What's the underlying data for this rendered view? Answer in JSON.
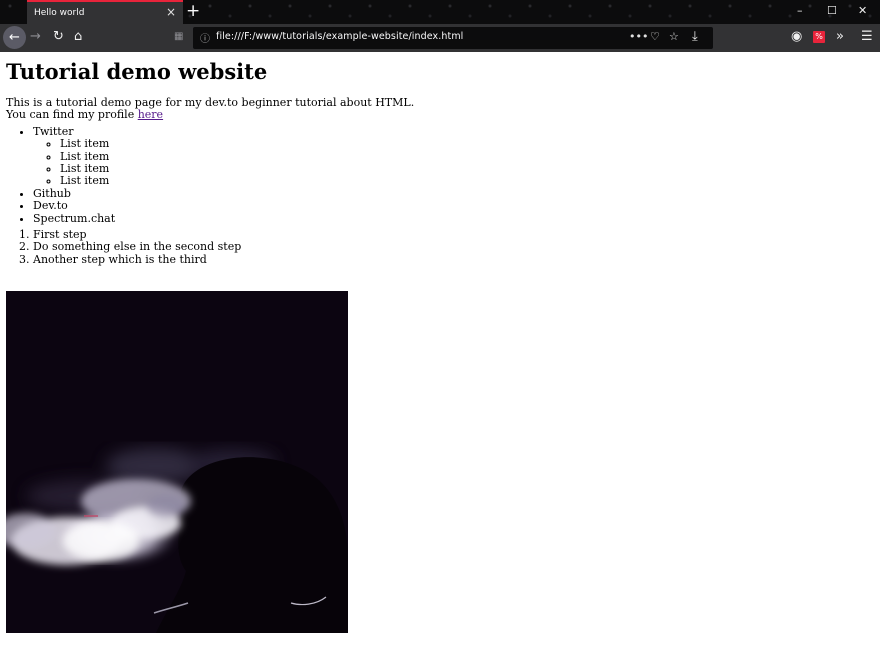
{
  "browser": {
    "tab_title": "Hello world",
    "tab_close": "×",
    "new_tab": "+",
    "window_controls": {
      "minimize": "–",
      "maximize": "☐",
      "close": "✕"
    },
    "url": "file:///F:/www/tutorials/example-website/index.html",
    "nav_icons": [
      "back-icon",
      "forward-icon",
      "reload-icon",
      "home-icon",
      "page-icon",
      "info-icon",
      "more-icon",
      "pocket-icon",
      "bookmark-star-icon",
      "download-icon",
      "ublock-icon",
      "extension-icon",
      "overflow-icon",
      "menu-icon"
    ],
    "accent_color": "#e8243b"
  },
  "page": {
    "heading": "Tutorial demo website",
    "intro_line1": "This is a tutorial demo page for my dev.to beginner tutorial about HTML.",
    "intro_line2": "You can find my profile ",
    "profile_link": "here",
    "social_list": [
      {
        "label": "Twitter",
        "children": [
          "List item",
          "List item",
          "List item",
          "List item"
        ]
      },
      {
        "label": "Github"
      },
      {
        "label": "Dev.to"
      },
      {
        "label": "Spectrum.chat"
      }
    ],
    "steps": [
      "First step",
      "Do something else in the second step",
      "Another step which is the third"
    ]
  }
}
